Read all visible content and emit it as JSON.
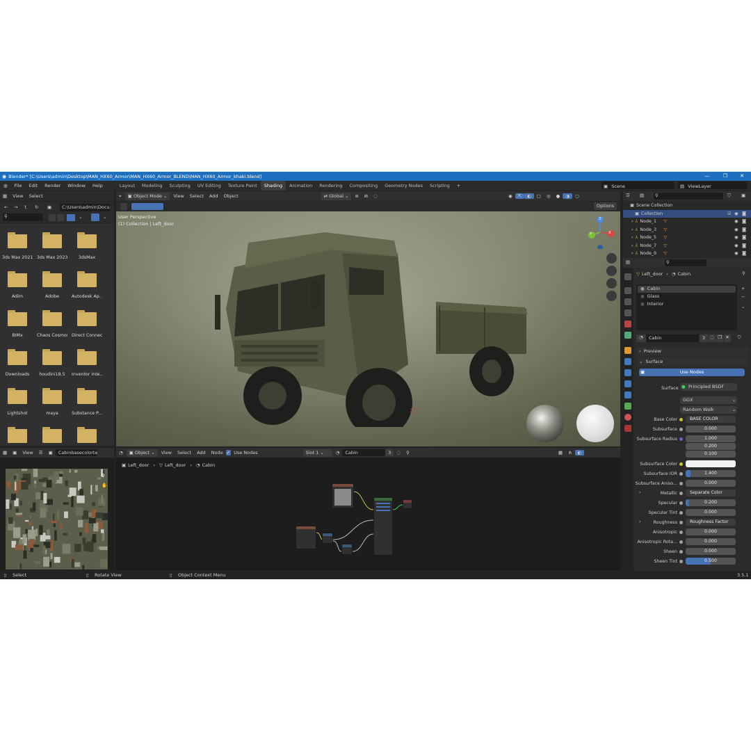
{
  "title": "Blender* [C:\\Users\\admin\\Desktop\\MAN_HX60_Armor\\MAN_HX60_Armor_BLEND\\MAN_HX60_Armor_khaki.blend]",
  "menu": [
    "File",
    "Edit",
    "Render",
    "Window",
    "Help"
  ],
  "workspaces": [
    "Layout",
    "Modeling",
    "Sculpting",
    "UV Editing",
    "Texture Paint",
    "Shading",
    "Animation",
    "Rendering",
    "Compositing",
    "Geometry Nodes",
    "Scripting"
  ],
  "active_workspace": "Shading",
  "scene": "Scene",
  "view_layer": "ViewLayer",
  "file_browser": {
    "menu": [
      "View",
      "Select"
    ],
    "path": "C:\\Users\\admin\\Docu...",
    "folders": [
      "3ds Max 2021",
      "3ds Max 2023",
      "3dsMax",
      "Adim",
      "Adobe",
      "Autodesk Ap...",
      "BIMx",
      "Chaos Cosmos",
      "Direct Connect",
      "Downloads",
      "houdini18.5",
      "Inventor Inte...",
      "Lightshot",
      "maya",
      "Substance P...",
      "",
      "",
      ""
    ]
  },
  "viewport": {
    "mode": "Object Mode",
    "menu": [
      "View",
      "Select",
      "Add",
      "Object"
    ],
    "transform": "Global",
    "options": "Options",
    "perspective": "User Perspective",
    "collection": "(1) Collection | Left_door",
    "gizmo": {
      "z": "Z",
      "y": "Y",
      "x": "X"
    }
  },
  "outliner": {
    "root": "Scene Collection",
    "collection": "Collection",
    "nodes": [
      "Node_1",
      "Node_3",
      "Node_5",
      "Node_7",
      "Node_9"
    ]
  },
  "properties": {
    "breadcrumb": [
      "Left_door",
      "Cabin"
    ],
    "materials": [
      "Cabin",
      "Glass",
      "Interior"
    ],
    "material_name": "Cabin",
    "users": "3",
    "preview": "Preview",
    "surface_section": "Surface",
    "use_nodes": "Use Nodes",
    "surface_label": "Surface",
    "surface_value": "Principled BSDF",
    "distribution": "GGX",
    "subsurface_method": "Random Walk",
    "rows": [
      {
        "label": "Base Color",
        "value": "BASE COLOR"
      },
      {
        "label": "Subsurface",
        "value": "0.000"
      },
      {
        "label": "Subsurface Radius",
        "value": "1.000"
      },
      {
        "label": "",
        "value": "0.200"
      },
      {
        "label": "",
        "value": "0.100"
      },
      {
        "label": "Subsurface Color",
        "value": ""
      },
      {
        "label": "Subsurface IOR",
        "value": "1.400"
      },
      {
        "label": "Subsurface Aniso...",
        "value": "0.000"
      },
      {
        "label": "Metallic",
        "value": "Separate Color"
      },
      {
        "label": "Specular",
        "value": "0.200"
      },
      {
        "label": "Specular Tint",
        "value": "0.000"
      },
      {
        "label": "Roughness",
        "value": "Roughness Factor"
      },
      {
        "label": "Anisotropic",
        "value": "0.000"
      },
      {
        "label": "Anisotropic Rota...",
        "value": "0.000"
      },
      {
        "label": "Sheen",
        "value": "0.000"
      },
      {
        "label": "Sheen Tint",
        "value": "0.500"
      }
    ]
  },
  "image_editor": {
    "menu": [
      "View"
    ],
    "image": "Cabinbasecolortextu..."
  },
  "node_editor": {
    "object": "Object",
    "menu": [
      "View",
      "Select",
      "Add",
      "Node"
    ],
    "use_nodes": "Use Nodes",
    "slot": "Slot 1",
    "material": "Cabin",
    "users": "3",
    "breadcrumb": [
      "Left_door",
      "Left_door",
      "Cabin"
    ]
  },
  "status": {
    "select": "Select",
    "rotate": "Rotate View",
    "context": "Object Context Menu",
    "version": "3.5.1"
  },
  "colors": {
    "accent": "#4772b3",
    "title": "#1e6fbf",
    "folder": "#d4b264"
  }
}
